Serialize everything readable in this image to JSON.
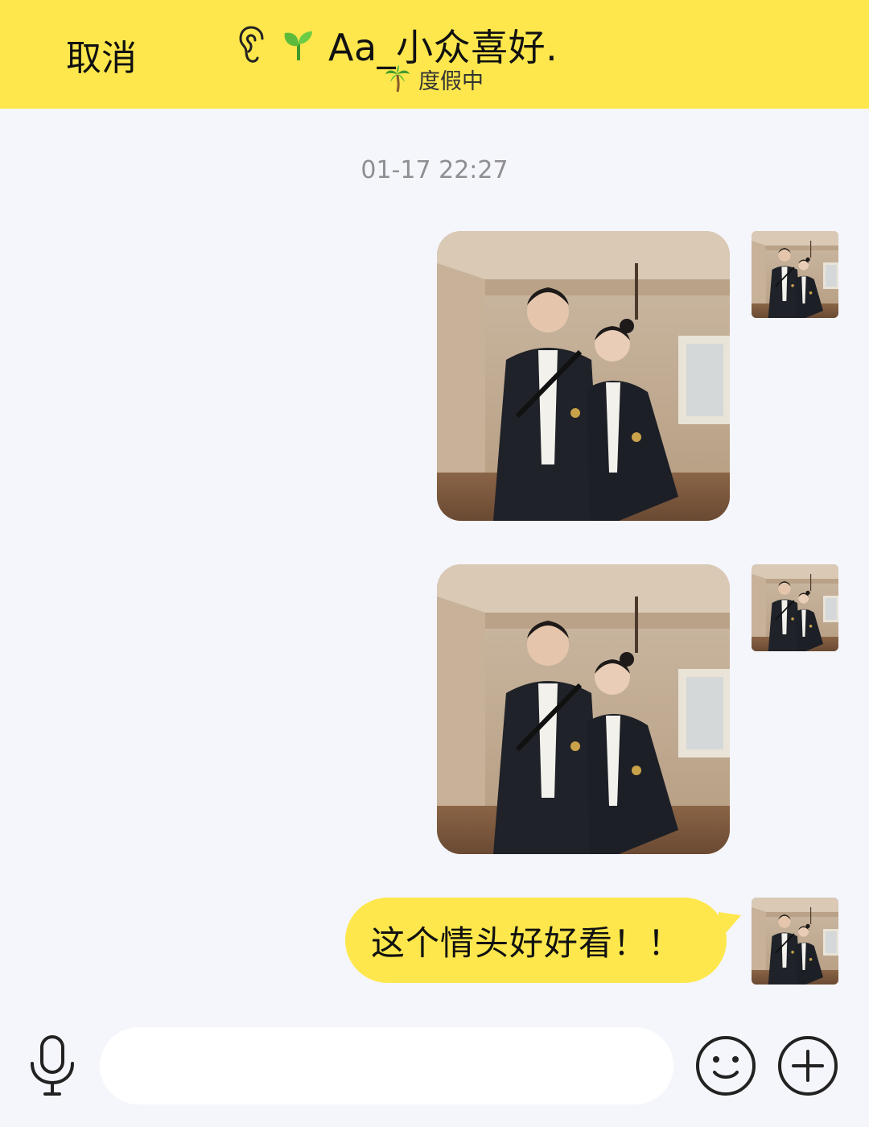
{
  "header": {
    "cancel_label": "取消",
    "contact_name": "Aa_小众喜好.",
    "status_text": "度假中",
    "icons": [
      "ear-icon",
      "sprout-icon",
      "palm-tree-icon"
    ],
    "background_color": "#fde74c"
  },
  "chat": {
    "timestamp": "01-17 22:27",
    "messages": [
      {
        "type": "image",
        "sender": "self",
        "icon": "couple-photo"
      },
      {
        "type": "image",
        "sender": "self",
        "icon": "couple-photo"
      },
      {
        "type": "text",
        "sender": "self",
        "text": "这个情头好好看！！"
      }
    ],
    "bubble_color": "#fde74c"
  },
  "input_bar": {
    "value": "",
    "placeholder": "",
    "icons": [
      "microphone-icon",
      "emoji-icon",
      "plus-icon"
    ]
  }
}
